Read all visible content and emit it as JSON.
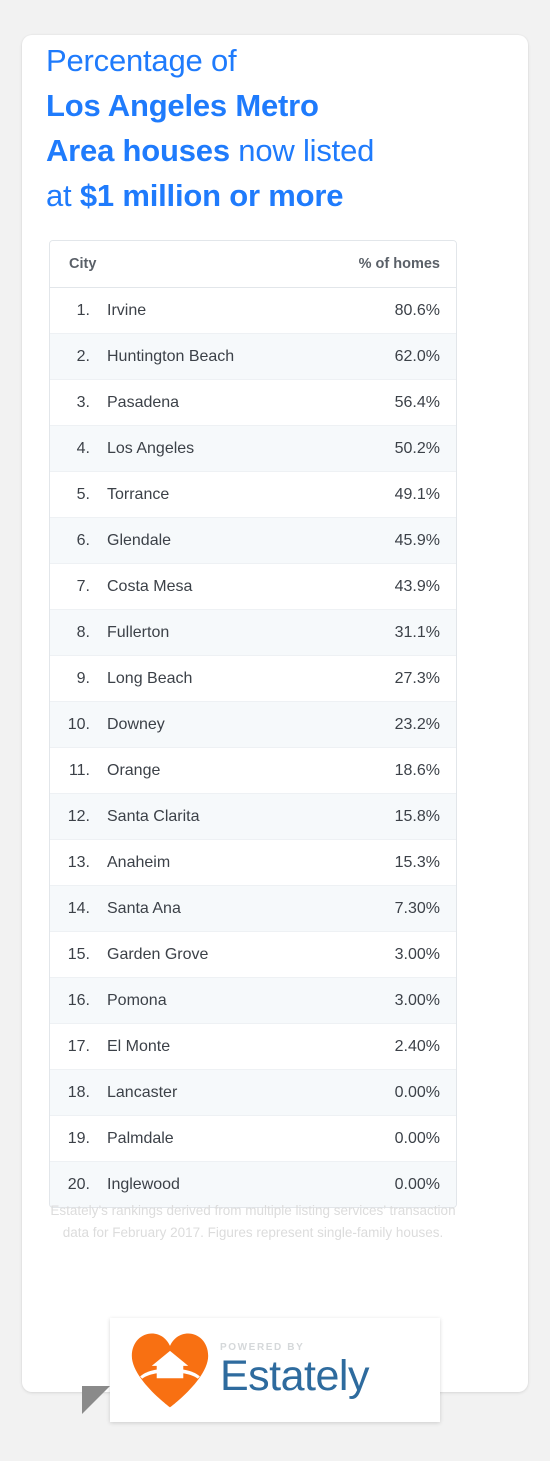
{
  "headline": {
    "line1": "Percentage of",
    "line2": "Los Angeles Metro",
    "line3_bold": "Area houses",
    "line3_rest": " now listed",
    "line4_pre": "at ",
    "line4_bold": "$1 million or more",
    "accent_color": "#1f7bfc"
  },
  "table": {
    "header": {
      "city": "City",
      "percent": "% of homes"
    },
    "rows": [
      {
        "rank": "1.",
        "city": "Irvine",
        "pct": "80.6%"
      },
      {
        "rank": "2.",
        "city": "Huntington Beach",
        "pct": "62.0%"
      },
      {
        "rank": "3.",
        "city": "Pasadena",
        "pct": "56.4%"
      },
      {
        "rank": "4.",
        "city": "Los Angeles",
        "pct": "50.2%"
      },
      {
        "rank": "5.",
        "city": "Torrance",
        "pct": "49.1%"
      },
      {
        "rank": "6.",
        "city": "Glendale",
        "pct": "45.9%"
      },
      {
        "rank": "7.",
        "city": "Costa Mesa",
        "pct": "43.9%"
      },
      {
        "rank": "8.",
        "city": "Fullerton",
        "pct": "31.1%"
      },
      {
        "rank": "9.",
        "city": "Long Beach",
        "pct": "27.3%"
      },
      {
        "rank": "10.",
        "city": "Downey",
        "pct": "23.2%"
      },
      {
        "rank": "11.",
        "city": "Orange",
        "pct": "18.6%"
      },
      {
        "rank": "12.",
        "city": "Santa Clarita",
        "pct": "15.8%"
      },
      {
        "rank": "13.",
        "city": "Anaheim",
        "pct": "15.3%"
      },
      {
        "rank": "14.",
        "city": "Santa Ana",
        "pct": "7.30%"
      },
      {
        "rank": "15.",
        "city": "Garden Grove",
        "pct": "3.00%"
      },
      {
        "rank": "16.",
        "city": "Pomona",
        "pct": "3.00%"
      },
      {
        "rank": "17.",
        "city": "El Monte",
        "pct": "2.40%"
      },
      {
        "rank": "18.",
        "city": "Lancaster",
        "pct": "0.00%"
      },
      {
        "rank": "19.",
        "city": "Palmdale",
        "pct": "0.00%"
      },
      {
        "rank": "20.",
        "city": "Inglewood",
        "pct": "0.00%"
      }
    ]
  },
  "footnote": {
    "text": "Estately’s rankings derived from multiple listing services’ transaction data for February 2017. Figures represent single-family houses."
  },
  "logo": {
    "powered_by": "POWERED BY",
    "wordmark": "Estately",
    "heart_color": "#f87012",
    "wordmark_color": "#2e6b9e"
  },
  "chart_data": {
    "type": "table",
    "title": "Percentage of Los Angeles Metro Area houses now listed at $1 million or more",
    "columns": [
      "City",
      "% of homes"
    ],
    "categories": [
      "Irvine",
      "Huntington Beach",
      "Pasadena",
      "Los Angeles",
      "Torrance",
      "Glendale",
      "Costa Mesa",
      "Fullerton",
      "Long Beach",
      "Downey",
      "Orange",
      "Santa Clarita",
      "Anaheim",
      "Santa Ana",
      "Garden Grove",
      "Pomona",
      "El Monte",
      "Lancaster",
      "Palmdale",
      "Inglewood"
    ],
    "values": [
      80.6,
      62.0,
      56.4,
      50.2,
      49.1,
      45.9,
      43.9,
      31.1,
      27.3,
      23.2,
      18.6,
      15.8,
      15.3,
      7.3,
      3.0,
      3.0,
      2.4,
      0.0,
      0.0,
      0.0
    ],
    "xlabel": "City",
    "ylabel": "% of homes",
    "ylim": [
      0,
      100
    ],
    "grid": false,
    "legend": "none",
    "annotations": [
      "Estately’s rankings derived from multiple listing services’ transaction data for February 2017. Figures represent single-family houses."
    ]
  }
}
